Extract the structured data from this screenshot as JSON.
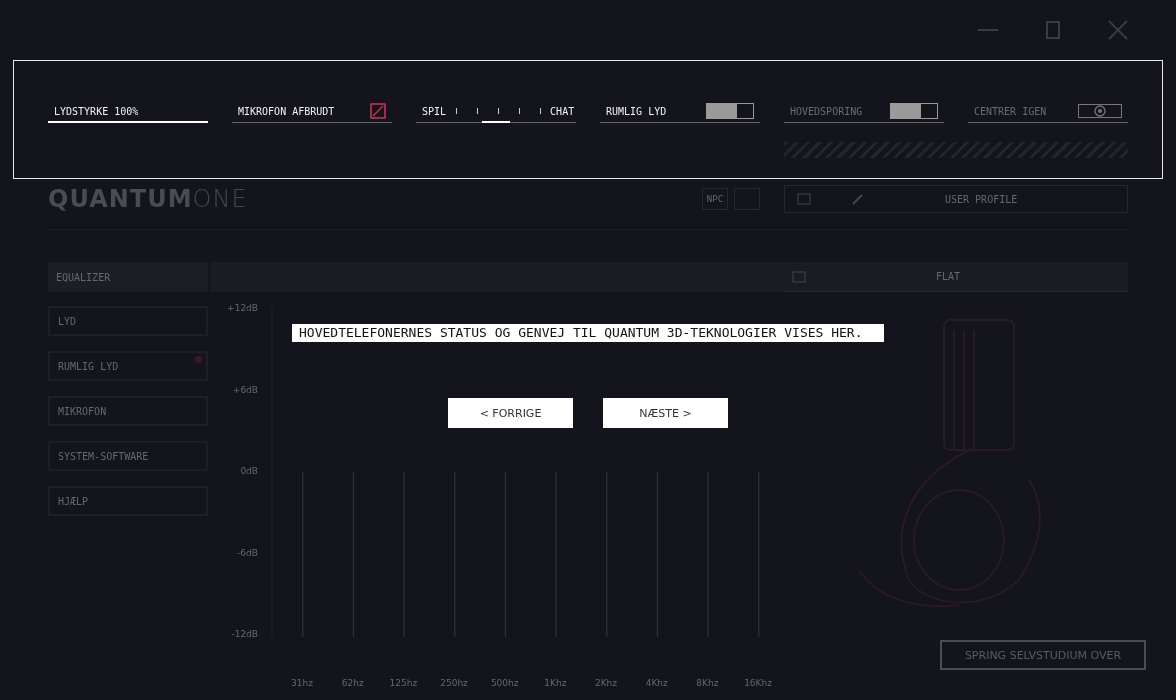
{
  "top_bar": {
    "controls": [
      {
        "kind": "slider",
        "label": "LYDSTYRKE 100%",
        "level": 1,
        "disabled": false
      },
      {
        "kind": "mic",
        "label": "MIKROFON AFBRUDT",
        "muted": true,
        "disabled": false
      },
      {
        "kind": "balance",
        "left": "SPIL",
        "right": "CHAT",
        "level": 0.5,
        "disabled": false
      },
      {
        "kind": "toggle",
        "label": "RUMLIG LYD",
        "on": true,
        "disabled": false
      },
      {
        "kind": "toggle",
        "label": "HOVEDSPORING",
        "on": true,
        "disabled": true
      },
      {
        "kind": "recenter",
        "label": "CENTRER IGEN",
        "disabled": true
      }
    ]
  },
  "logo": {
    "brand": "QUANTUM",
    "suffix": "ONE"
  },
  "header": {
    "npc_button": "NPC",
    "profile": "USER PROFILE"
  },
  "sidebar": {
    "title": "EQUALIZER",
    "items": [
      {
        "label": "LYD",
        "badge": false
      },
      {
        "label": "RUMLIG LYD",
        "badge": true
      },
      {
        "label": "MIKROFON",
        "badge": false
      },
      {
        "label": "SYSTEM-SOFTWARE",
        "badge": false
      },
      {
        "label": "HJÆLP",
        "badge": false
      }
    ]
  },
  "preset": {
    "label": "FLAT"
  },
  "equalizer": {
    "y_labels": [
      "+12dB",
      "+6dB",
      "0dB",
      "-6dB",
      "-12dB"
    ],
    "bands": [
      "31hz",
      "62hz",
      "125hz",
      "250hz",
      "500hz",
      "1Khz",
      "2Khz",
      "4Khz",
      "8Khz",
      "16Khz"
    ]
  },
  "tutorial": {
    "message": "HOVEDTELEFONERNES STATUS OG GENVEJ TIL QUANTUM 3D-TEKNOLOGIER VISES HER.",
    "prev": "< FORRIGE",
    "next": "NÆSTE >",
    "skip": "SPRING SELVSTUDIUM OVER"
  }
}
